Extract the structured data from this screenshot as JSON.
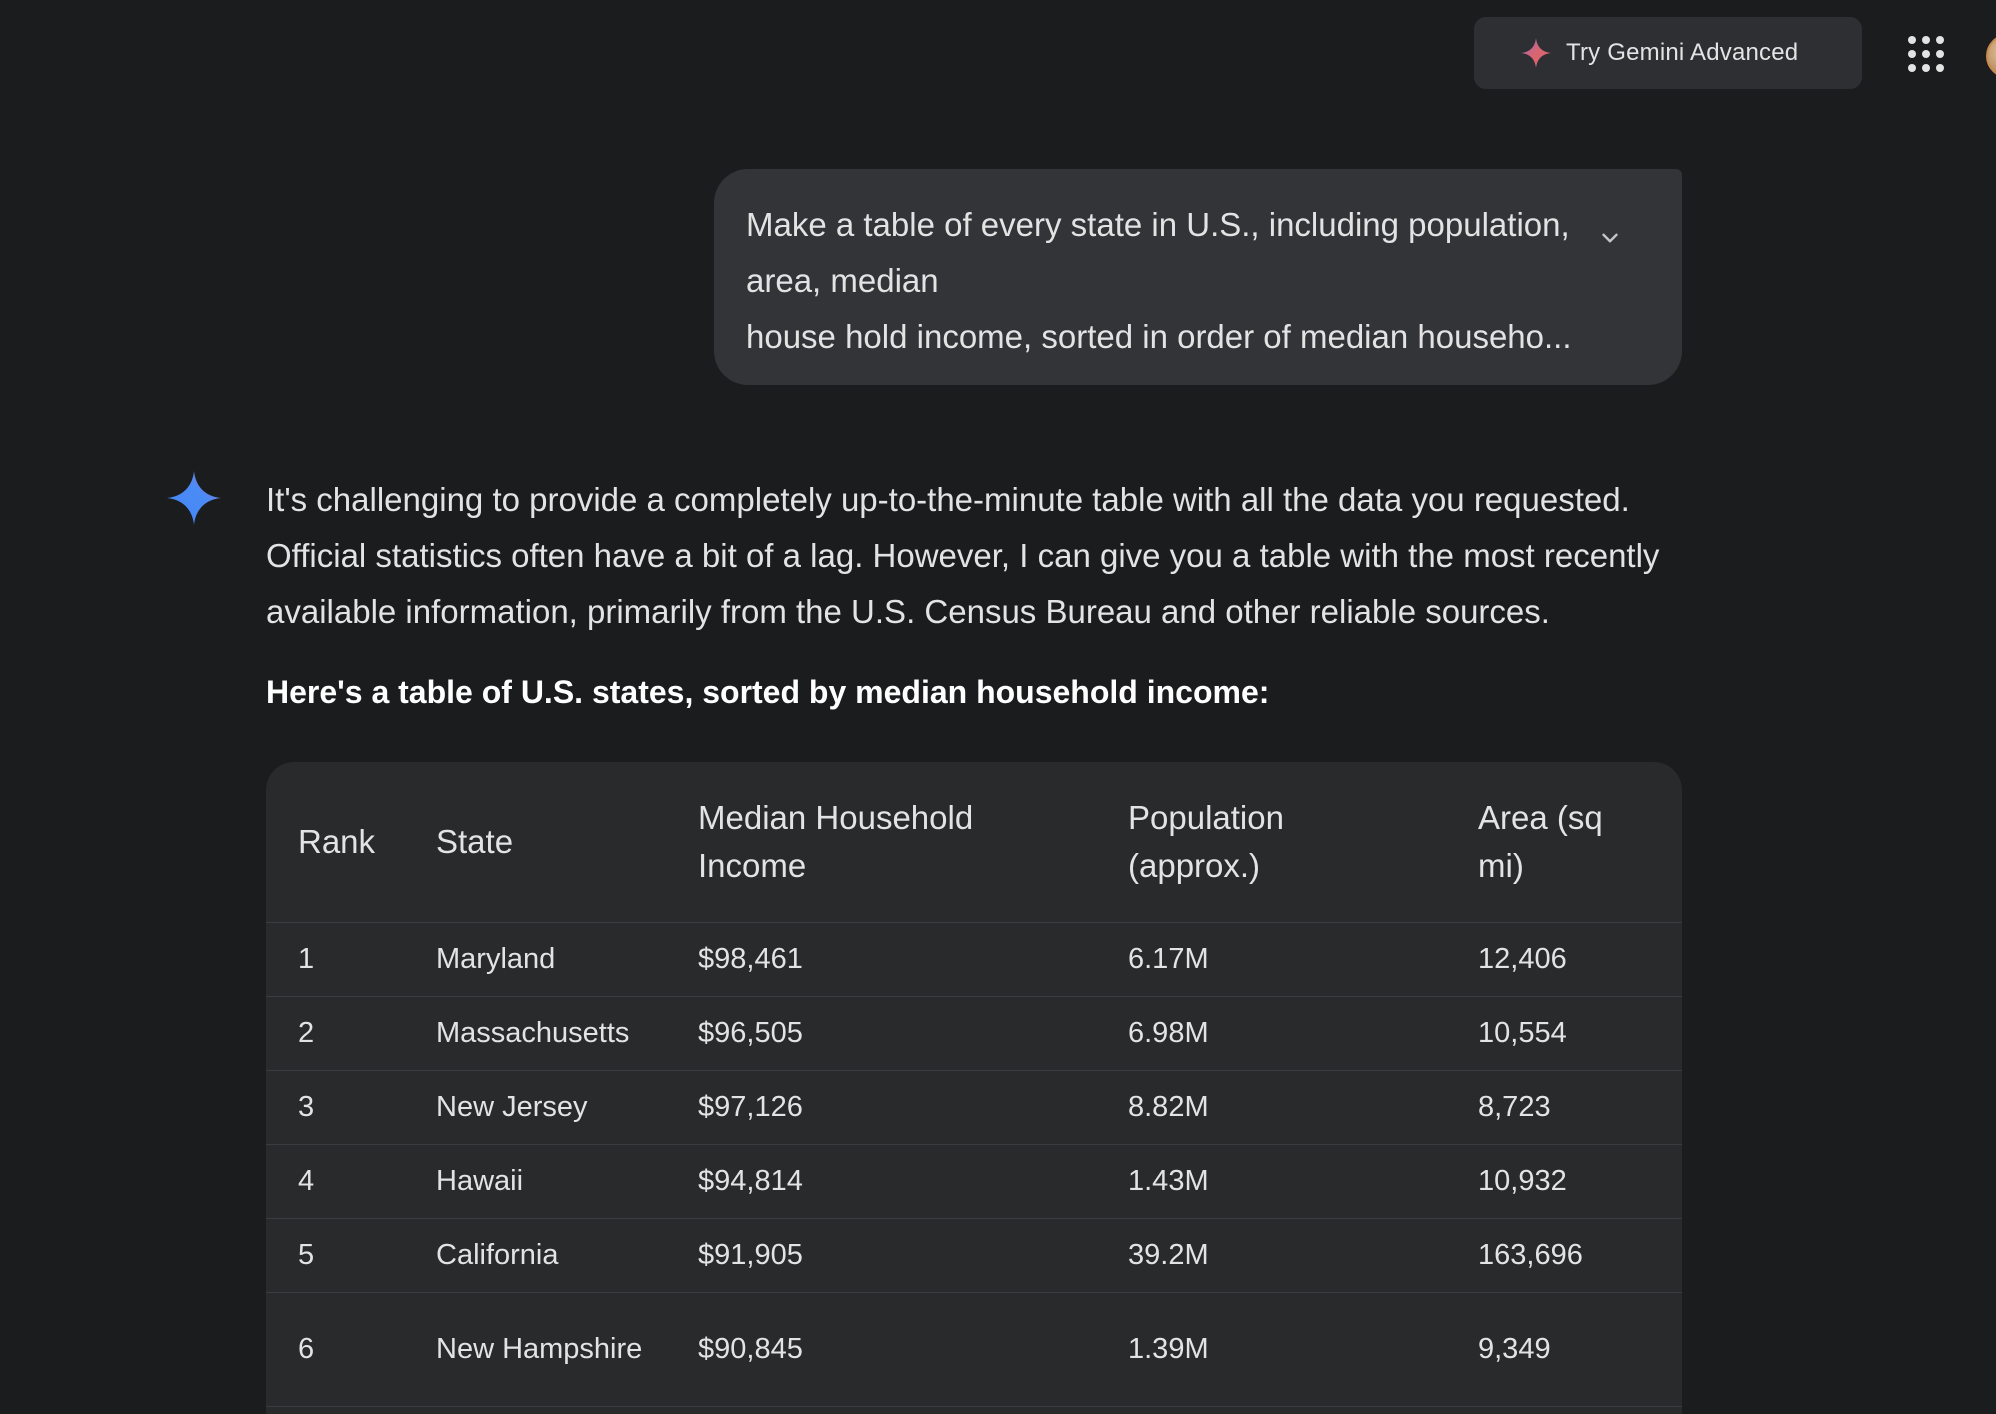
{
  "header": {
    "upgrade_label": "Try Gemini Advanced",
    "upgrade_icon": "sparkle-icon",
    "apps_icon": "apps-grid-icon"
  },
  "prompt": {
    "lines": [
      "Make a table of every state in U.S., including population,",
      "area, median",
      "house hold income, sorted in order of median househo..."
    ],
    "expand_icon": "chevron-down-icon"
  },
  "response": {
    "icon": "gemini-sparkle-icon",
    "lines": [
      "It's challenging to provide a completely up-to-the-minute table with all the data you requested.",
      "Official statistics often have a bit of a lag. However, I can give you a table with the most recently",
      "available information, primarily from the U.S. Census Bureau and other reliable sources."
    ],
    "heading": "Here's a table of U.S. states, sorted by median household income:"
  },
  "table": {
    "columns": [
      "Rank",
      "State",
      "Median Household Income",
      "Population (approx.)",
      "Area (sq mi)"
    ],
    "rows": [
      [
        "1",
        "Maryland",
        "$98,461",
        "6.17M",
        "12,406"
      ],
      [
        "2",
        "Massachusetts",
        "$96,505",
        "6.98M",
        "10,554"
      ],
      [
        "3",
        "New Jersey",
        "$97,126",
        "8.82M",
        "8,723"
      ],
      [
        "4",
        "Hawaii",
        "$94,814",
        "1.43M",
        "10,932"
      ],
      [
        "5",
        "California",
        "$91,905",
        "39.2M",
        "163,696"
      ],
      [
        "6",
        "New Hampshire",
        "$90,845",
        "1.39M",
        "9,349"
      ]
    ]
  },
  "colors": {
    "background": "#1b1c1e",
    "bubble": "#333437",
    "table_bg": "#282a2c",
    "gemini_blue": "#4b8bf5",
    "sparkle_red": "#d96570"
  }
}
